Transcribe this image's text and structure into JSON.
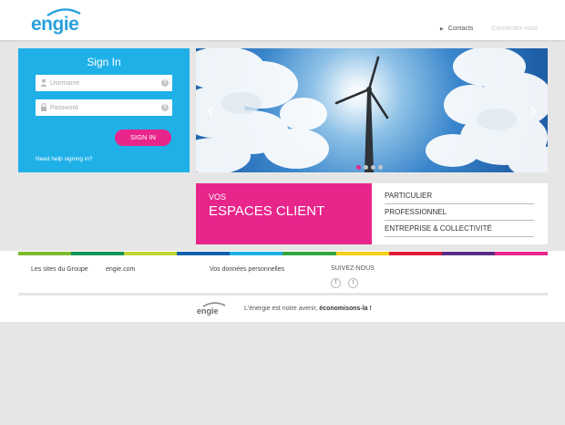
{
  "header": {
    "logo_text": "engie",
    "links": [
      {
        "label": "Contacts"
      },
      {
        "label": "Connectez-vous"
      }
    ]
  },
  "signin": {
    "title": "Sign In",
    "username_placeholder": "Username",
    "password_placeholder": "Password",
    "help_icon": "?",
    "button_label": "SIGN IN",
    "need_help": "Need help signing in?"
  },
  "carousel": {
    "prev": "❮",
    "next": "❯",
    "slides": 4,
    "active_slide": 1
  },
  "espaces": {
    "pre": "VOS",
    "title": "ESPACES CLIENT",
    "items": [
      "PARTICULIER",
      "PROFESSIONNEL",
      "ENTREPRISE & COLLECTIVITÉ"
    ]
  },
  "footer": {
    "colors": [
      "#7cbb2b",
      "#11965a",
      "#bfd431",
      "#1460aa",
      "#1fb0e8",
      "#34a73c",
      "#f6d00f",
      "#e0193a",
      "#5a2d87",
      "#e8258b"
    ],
    "les_sites": "Les sites du Groupe",
    "engie_com": "engie.com",
    "donnees": "Vos données personnelles",
    "suivez": "SUIVEZ-NOUS",
    "social": [
      {
        "name": "facebook-icon",
        "glyph": "f"
      },
      {
        "name": "twitter-icon",
        "glyph": "t"
      }
    ],
    "logo_text": "engie",
    "tagline_start": "L'énergie est notre avenir, ",
    "tagline_bold": "économisons-la !"
  },
  "colors": {
    "brand_blue": "#2aa1dd",
    "signin_bg": "#1fb0e8",
    "accent_pink": "#e8258b"
  }
}
